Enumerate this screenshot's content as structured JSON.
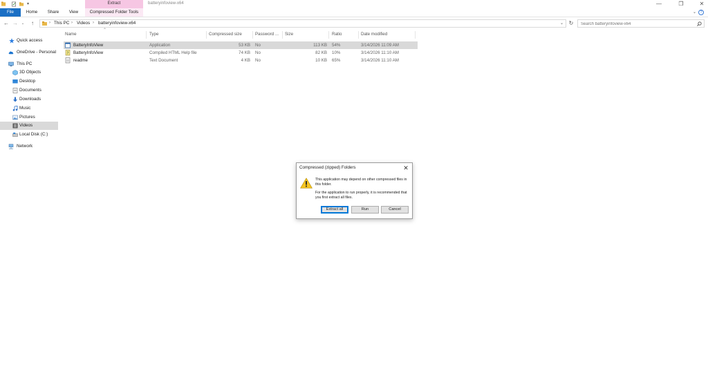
{
  "window": {
    "title": "batteryinfoview-x64",
    "contextual_group": "Extract",
    "controls": {
      "minimize": "—",
      "restore": "❐",
      "close": "✕"
    }
  },
  "ribbon": {
    "tabs": [
      "File",
      "Home",
      "Share",
      "View",
      "Compressed Folder Tools"
    ]
  },
  "address": {
    "crumbs": [
      "This PC",
      "Videos",
      "batteryinfoview-x64"
    ],
    "search_placeholder": "Search batteryinfoview-x64"
  },
  "nav": {
    "items": [
      {
        "label": "Quick access",
        "icon": "star-icon"
      },
      {
        "label": "OneDrive - Personal",
        "icon": "cloud-icon"
      },
      {
        "label": "This PC",
        "icon": "computer-icon"
      },
      {
        "label": "3D Objects",
        "icon": "cube-icon"
      },
      {
        "label": "Desktop",
        "icon": "desktop-icon"
      },
      {
        "label": "Documents",
        "icon": "document-icon"
      },
      {
        "label": "Downloads",
        "icon": "download-icon"
      },
      {
        "label": "Music",
        "icon": "music-icon"
      },
      {
        "label": "Pictures",
        "icon": "picture-icon"
      },
      {
        "label": "Videos",
        "icon": "video-icon"
      },
      {
        "label": "Local Disk (C:)",
        "icon": "disk-icon"
      },
      {
        "label": "Network",
        "icon": "network-icon"
      }
    ]
  },
  "files": {
    "columns": [
      "Name",
      "Type",
      "Compressed size",
      "Password ...",
      "Size",
      "Ratio",
      "Date modified"
    ],
    "rows": [
      {
        "name": "BatteryInfoView",
        "type": "Application",
        "compressed": "53 KB",
        "password": "No",
        "size": "113 KB",
        "ratio": "54%",
        "date": "3/14/2026 11:09 AM",
        "icon": "application-icon"
      },
      {
        "name": "BatteryInfoView",
        "type": "Compiled HTML Help file",
        "compressed": "74 KB",
        "password": "No",
        "size": "82 KB",
        "ratio": "10%",
        "date": "3/14/2026 11:10 AM",
        "icon": "help-file-icon"
      },
      {
        "name": "readme",
        "type": "Text Document",
        "compressed": "4 KB",
        "password": "No",
        "size": "10 KB",
        "ratio": "65%",
        "date": "3/14/2026 11:10 AM",
        "icon": "text-file-icon"
      }
    ]
  },
  "dialog": {
    "title": "Compressed (zipped) Folders",
    "message1": "This application may depend on other compressed files in this folder.",
    "message2": "For the application to run properly, it is recommended that you first extract all files.",
    "buttons": {
      "extract_all": "Extract all",
      "run": "Run",
      "cancel": "Cancel"
    },
    "close": "✕"
  },
  "colors": {
    "accent": "#1a6fc4",
    "contextual": "#f6c6e3",
    "selection": "#d9d9d9",
    "folder": "#e8b84a"
  }
}
